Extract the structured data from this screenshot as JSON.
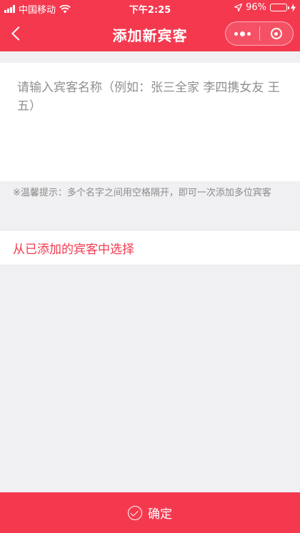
{
  "status_bar": {
    "carrier": "中国移动",
    "time": "下午2:25",
    "battery": "96%",
    "battery_level": 0.96,
    "icons": [
      "signal-icon",
      "wifi-icon",
      "location-arrow-icon",
      "battery-icon",
      "charging-icon"
    ]
  },
  "navbar": {
    "title": "添加新宾客",
    "back_icon": "chevron-left-icon",
    "more_icon": "more-dots-icon",
    "close_icon": "close-target-icon"
  },
  "guest_input": {
    "value": "",
    "placeholder": "请输入宾客名称（例如：张三全家 李四携女友 王五）"
  },
  "tip": {
    "text": "※温馨提示：多个名字之间用空格隔开，即可一次添加多位宾客"
  },
  "select_existing": {
    "label": "从已添加的宾客中选择"
  },
  "confirm_button": {
    "label": "确定",
    "icon": "check-circle-icon"
  },
  "colors": {
    "primary": "#f4394f",
    "background": "#f0f0f2",
    "tip_text": "#8a8a8a",
    "battery_fill": "#4cd964"
  }
}
